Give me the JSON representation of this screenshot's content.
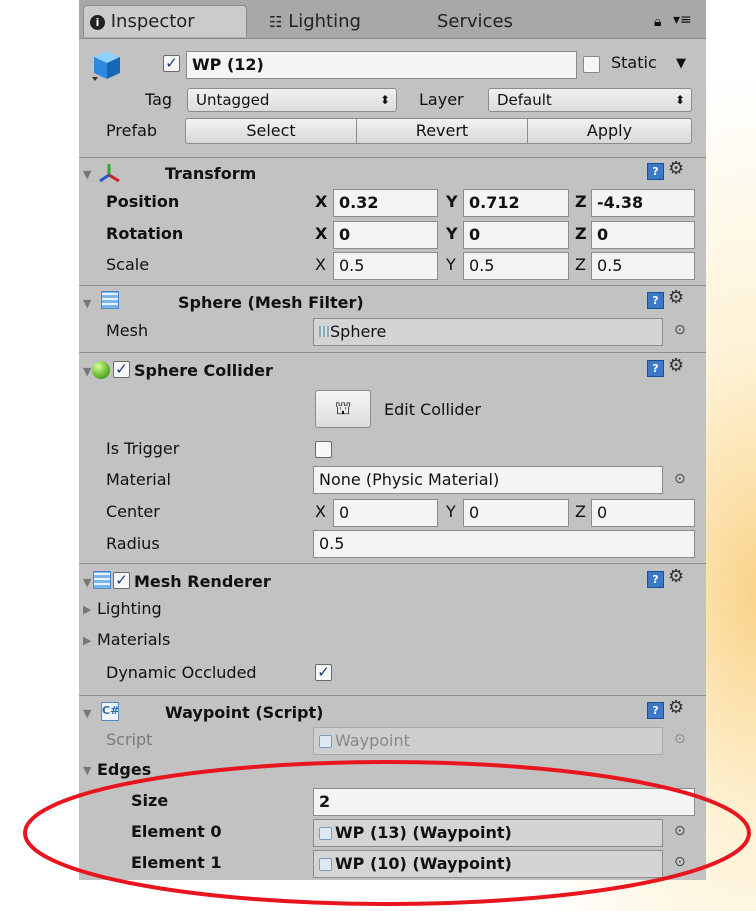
{
  "tabs": {
    "inspector": "Inspector",
    "lighting": "Lighting",
    "services": "Services"
  },
  "header": {
    "object_name": "WP (12)",
    "static_label": "Static",
    "tag_label": "Tag",
    "tag_value": "Untagged",
    "layer_label": "Layer",
    "layer_value": "Default",
    "prefab_label": "Prefab",
    "prefab_buttons": {
      "select": "Select",
      "revert": "Revert",
      "apply": "Apply"
    }
  },
  "transform": {
    "title": "Transform",
    "position_label": "Position",
    "position": {
      "x": "0.32",
      "y": "0.712",
      "z": "-4.38"
    },
    "rotation_label": "Rotation",
    "rotation": {
      "x": "0",
      "y": "0",
      "z": "0"
    },
    "scale_label": "Scale",
    "scale": {
      "x": "0.5",
      "y": "0.5",
      "z": "0.5"
    }
  },
  "mesh_filter": {
    "title": "Sphere (Mesh Filter)",
    "mesh_label": "Mesh",
    "mesh_value": "Sphere"
  },
  "sphere_collider": {
    "title": "Sphere Collider",
    "edit_collider": "Edit Collider",
    "is_trigger_label": "Is Trigger",
    "material_label": "Material",
    "material_value": "None (Physic Material)",
    "center_label": "Center",
    "center": {
      "x": "0",
      "y": "0",
      "z": "0"
    },
    "radius_label": "Radius",
    "radius_value": "0.5"
  },
  "mesh_renderer": {
    "title": "Mesh Renderer",
    "lighting_label": "Lighting",
    "materials_label": "Materials",
    "dynamic_occluded_label": "Dynamic Occluded"
  },
  "waypoint": {
    "title": "Waypoint (Script)",
    "script_label": "Script",
    "script_value": "Waypoint",
    "edges_label": "Edges",
    "size_label": "Size",
    "size_value": "2",
    "element0_label": "Element 0",
    "element0_value": "WP (13) (Waypoint)",
    "element1_label": "Element 1",
    "element1_value": "WP (10) (Waypoint)"
  },
  "axis_labels": {
    "x": "X",
    "y": "Y",
    "z": "Z"
  },
  "colors": {
    "highlight_ellipse": "#e8141e",
    "panel_bg": "#c2c2c2",
    "accent_blue": "#3a78c8"
  },
  "icons": [
    "info-icon",
    "lighting-tab-icon",
    "lock-icon",
    "tab-menu-icon",
    "cube-icon",
    "transform-axes-icon",
    "mesh-filter-icon",
    "sphere-collider-icon",
    "mesh-renderer-icon",
    "script-icon",
    "help-icon",
    "gear-icon",
    "object-picker-icon",
    "edit-collider-icon"
  ]
}
